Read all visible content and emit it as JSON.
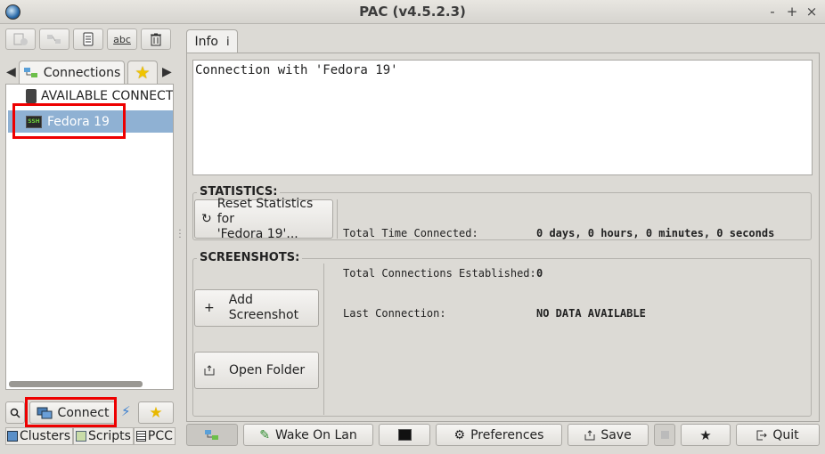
{
  "window": {
    "title": "PAC (v4.5.2.3)",
    "minimize": "-",
    "maximize": "+",
    "close": "×"
  },
  "left": {
    "tabs": {
      "connections": "Connections"
    },
    "tree": [
      {
        "label": "AVAILABLE CONNECT"
      },
      {
        "label": "Fedora 19",
        "badge": "SSH"
      }
    ],
    "buttons": {
      "connect": "Connect"
    },
    "bottom_tabs": [
      "Clusters",
      "Scripts",
      "PCC"
    ]
  },
  "info": {
    "tab_label": "Info",
    "tab_suffix": "i",
    "description": "Connection with 'Fedora 19'",
    "statistics": {
      "label": "STATISTICS:",
      "reset_line1": "Reset Statistics for",
      "reset_line2": "'Fedora 19'...",
      "rows": [
        {
          "key": "Total Time Connected:",
          "value": "0 days, 0 hours, 0 minutes, 0 seconds"
        },
        {
          "key": "Total Connections Established:",
          "value": "0"
        },
        {
          "key": "Last Connection:",
          "value": "NO DATA AVAILABLE"
        }
      ]
    },
    "screenshots": {
      "label": "SCREENSHOTS:",
      "add_line1": "Add",
      "add_line2": "Screenshot",
      "open_folder": "Open Folder"
    }
  },
  "bottom_bar": {
    "wake_on_lan": "Wake On Lan",
    "preferences": "Preferences",
    "save": "Save",
    "quit": "Quit"
  }
}
